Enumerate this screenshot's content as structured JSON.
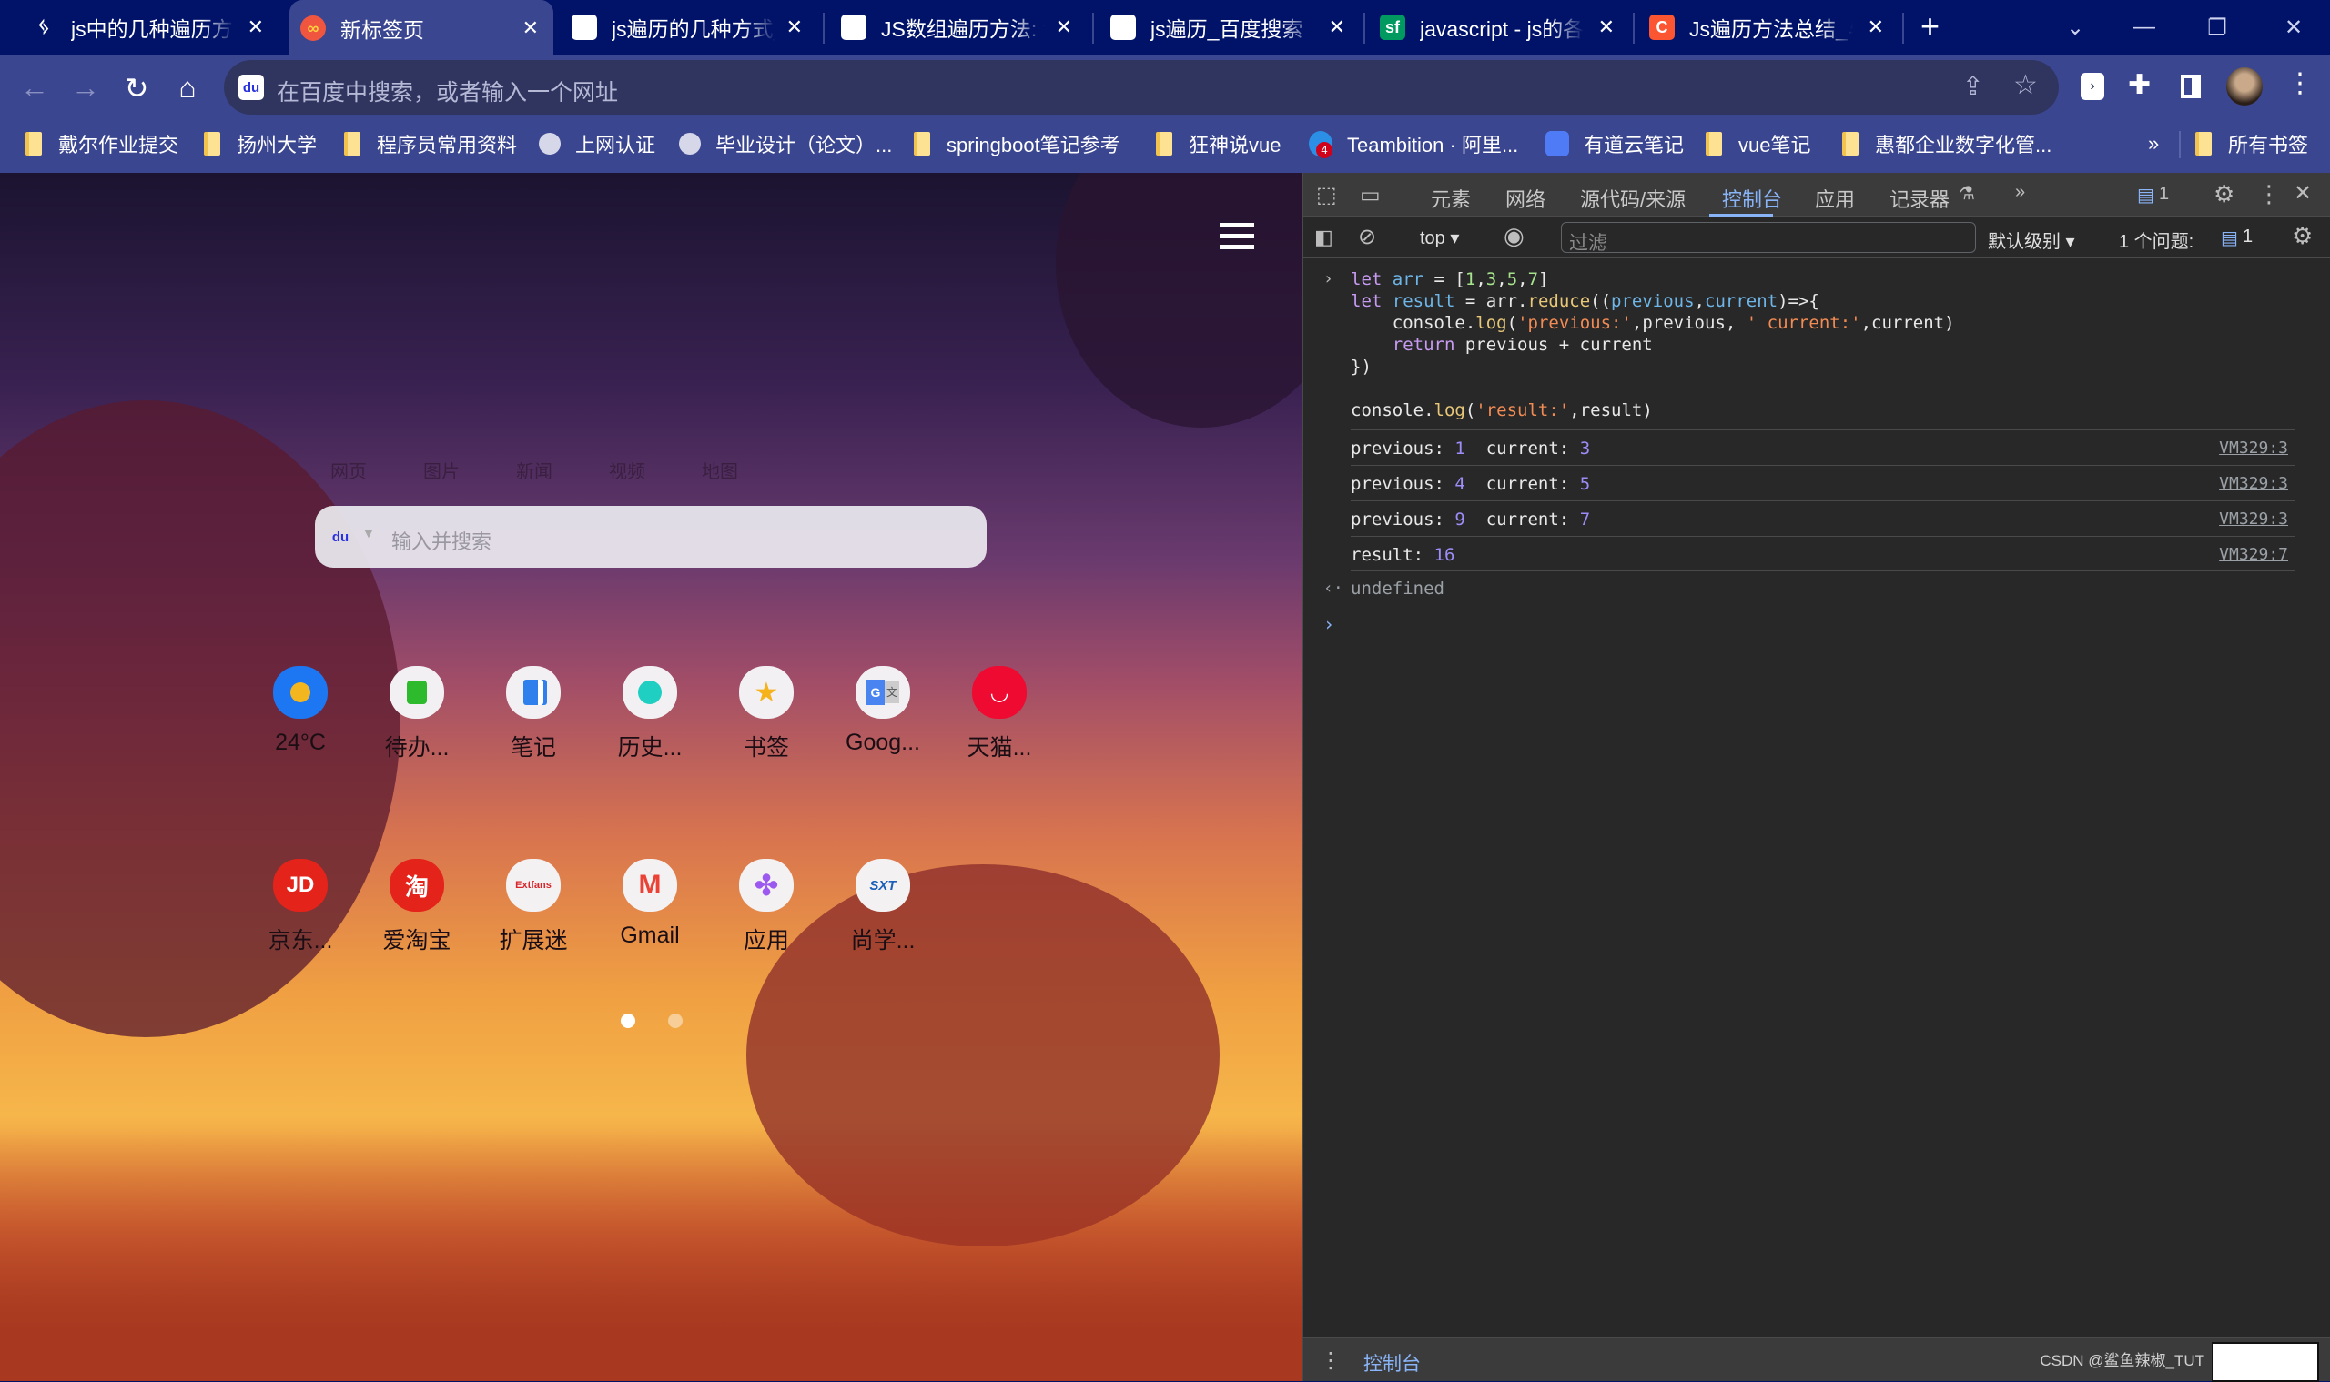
{
  "browser": {
    "tabs": [
      {
        "title": "js中的几种遍历方法",
        "favicon": "yuque-icon",
        "active": false
      },
      {
        "title": "新标签页",
        "favicon": "infinity-newtab-icon",
        "active": true
      },
      {
        "title": "js遍历的几种方式_j",
        "favicon": "baidu-icon",
        "active": false
      },
      {
        "title": "JS数组遍历方法: f",
        "favicon": "baidu-icon",
        "active": false
      },
      {
        "title": "js遍历_百度搜索",
        "favicon": "baidu-icon",
        "active": false
      },
      {
        "title": "javascript - js的各",
        "favicon": "segmentfault-icon",
        "active": false
      },
      {
        "title": "Js遍历方法总结_与",
        "favicon": "csdn-icon",
        "active": false
      }
    ],
    "new_tab_symbol": "+",
    "window_controls": {
      "tab_search": "⌄",
      "minimize": "—",
      "restore": "❐",
      "close": "✕"
    },
    "omnibox_placeholder": "在百度中搜索，或者输入一个网址",
    "bookmarks": [
      {
        "label": "戴尔作业提交",
        "icon": "folder-icon"
      },
      {
        "label": "扬州大学",
        "icon": "folder-icon"
      },
      {
        "label": "程序员常用资料",
        "icon": "folder-icon"
      },
      {
        "label": "上网认证",
        "icon": "globe-icon"
      },
      {
        "label": "毕业设计（论文）...",
        "icon": "globe-icon"
      },
      {
        "label": "springboot笔记参考",
        "icon": "folder-icon"
      },
      {
        "label": "狂神说vue",
        "icon": "folder-icon"
      },
      {
        "label": "Teambition · 阿里...",
        "icon": "teambition-icon",
        "badge": "4"
      },
      {
        "label": "有道云笔记",
        "icon": "youdao-icon"
      },
      {
        "label": "vue笔记",
        "icon": "folder-icon"
      },
      {
        "label": "惠都企业数字化管...",
        "icon": "folder-icon"
      }
    ],
    "bookmarks_overflow": "»",
    "all_bookmarks": "所有书签"
  },
  "newtab": {
    "search_tabs": [
      "网页",
      "图片",
      "新闻",
      "视频",
      "地图"
    ],
    "search_placeholder": "输入并搜索",
    "row1": [
      {
        "label": "24°C",
        "icon": "weather-icon",
        "bg": "#1d77f2"
      },
      {
        "label": "待办...",
        "icon": "todo-icon",
        "bg": "#f2f0f3"
      },
      {
        "label": "笔记",
        "icon": "notes-icon",
        "bg": "#f2f0f3"
      },
      {
        "label": "历史...",
        "icon": "history-clock-icon",
        "bg": "#f2f0f3"
      },
      {
        "label": "书签",
        "icon": "star-icon",
        "bg": "#f2f0f3"
      },
      {
        "label": "Goog...",
        "icon": "google-translate-icon",
        "bg": "#f2f0f3"
      },
      {
        "label": "天猫...",
        "icon": "tmall-icon",
        "bg": "#ee0a30"
      }
    ],
    "row2": [
      {
        "label": "京东...",
        "icon": "jd-icon",
        "glyph": "JD",
        "bg": "#e4231a"
      },
      {
        "label": "爱淘宝",
        "icon": "taobao-icon",
        "glyph": "淘",
        "bg": "#e4231a"
      },
      {
        "label": "扩展迷",
        "icon": "extfans-icon",
        "glyph": "Extfans",
        "bg": "#f4f1f3"
      },
      {
        "label": "Gmail",
        "icon": "gmail-icon",
        "glyph": "M",
        "bg": "#f4f1f3"
      },
      {
        "label": "应用",
        "icon": "apps-icon",
        "glyph": "",
        "bg": "#f4f1f3"
      },
      {
        "label": "尚学...",
        "icon": "sxt-icon",
        "glyph": "SXT",
        "bg": "#f4f1f3"
      }
    ],
    "page_dots": {
      "count": 2,
      "current": 1
    }
  },
  "devtools": {
    "tabs": [
      "元素",
      "网络",
      "源代码/来源",
      "控制台",
      "应用",
      "记录器"
    ],
    "active_tab": "控制台",
    "more_tabs": "»",
    "issues_badge": "1",
    "context": "top",
    "filter_placeholder": "过滤",
    "log_level": "默认级别",
    "issues_text": "1 个问题:",
    "issues_count": "1",
    "console": {
      "input_lines": [
        "let arr = [1,3,5,7]",
        "let result = arr.reduce((previous,current)=>{",
        "    console.log('previous:',previous, ' current:',current)",
        "    return previous + current",
        "})",
        "",
        "console.log('result:',result)"
      ],
      "logs": [
        {
          "text": "previous: ",
          "v1": "1",
          "mid": "  current: ",
          "v2": "3",
          "source": "VM329:3"
        },
        {
          "text": "previous: ",
          "v1": "4",
          "mid": "  current: ",
          "v2": "5",
          "source": "VM329:3"
        },
        {
          "text": "previous: ",
          "v1": "9",
          "mid": "  current: ",
          "v2": "7",
          "source": "VM329:3"
        },
        {
          "text": "result: ",
          "v1": "16",
          "mid": "",
          "v2": "",
          "source": "VM329:7"
        }
      ],
      "return_value": "undefined"
    },
    "drawer_tab": "控制台",
    "watermark": "CSDN @鲨鱼辣椒_TUT"
  }
}
